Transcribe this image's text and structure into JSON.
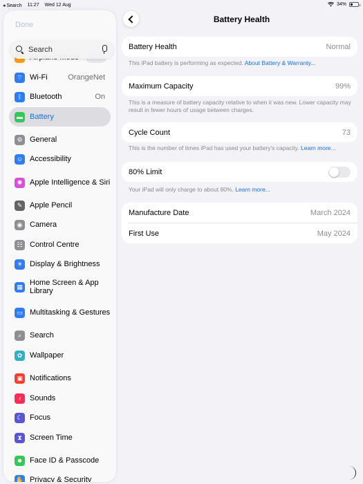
{
  "status_bar": {
    "back_app": "◂ Search",
    "time": "11:27",
    "date": "Wed 12 Aug",
    "battery": "34%",
    "battery_level": 0.34
  },
  "sidebar": {
    "done_label": "Done",
    "search_placeholder": "Search",
    "partial_item": "Airplane Mode",
    "items": [
      {
        "label": "Wi-Fi",
        "value": "OrangeNet",
        "icon": "wifi-icon",
        "color": "#2f7cf6"
      },
      {
        "label": "Bluetooth",
        "value": "On",
        "icon": "bluetooth-icon",
        "color": "#2f7cf6"
      },
      {
        "label": "Battery",
        "value": "",
        "icon": "battery-icon",
        "color": "#34c759"
      },
      {
        "label": "General",
        "value": "",
        "icon": "gear-icon",
        "color": "#8e8e93"
      },
      {
        "label": "Accessibility",
        "value": "",
        "icon": "accessibility-icon",
        "color": "#2f7cf6"
      },
      {
        "label": "Apple Intelligence & Siri",
        "value": "",
        "icon": "siri-icon",
        "color": "#d94fd8"
      },
      {
        "label": "Apple Pencil",
        "value": "",
        "icon": "pencil-icon",
        "color": "#636366"
      },
      {
        "label": "Camera",
        "value": "",
        "icon": "camera-icon",
        "color": "#8e8e93"
      },
      {
        "label": "Control Centre",
        "value": "",
        "icon": "control-centre-icon",
        "color": "#8e8e93"
      },
      {
        "label": "Display & Brightness",
        "value": "",
        "icon": "brightness-icon",
        "color": "#2f7cf6"
      },
      {
        "label": "Home Screen & App Library",
        "value": "",
        "icon": "home-screen-icon",
        "color": "#2f7cf6"
      },
      {
        "label": "Multitasking & Gestures",
        "value": "",
        "icon": "multitasking-icon",
        "color": "#2f7cf6"
      },
      {
        "label": "Search",
        "value": "",
        "icon": "search-icon",
        "color": "#8e8e93"
      },
      {
        "label": "Wallpaper",
        "value": "",
        "icon": "wallpaper-icon",
        "color": "#30b0c7"
      },
      {
        "label": "Notifications",
        "value": "",
        "icon": "notifications-icon",
        "color": "#ff3b30"
      },
      {
        "label": "Sounds",
        "value": "",
        "icon": "sounds-icon",
        "color": "#ff2d55"
      },
      {
        "label": "Focus",
        "value": "",
        "icon": "focus-icon",
        "color": "#5856d6"
      },
      {
        "label": "Screen Time",
        "value": "",
        "icon": "screen-time-icon",
        "color": "#5856d6"
      },
      {
        "label": "Face ID & Passcode",
        "value": "",
        "icon": "face-id-icon",
        "color": "#34c759"
      },
      {
        "label": "Privacy & Security",
        "value": "",
        "icon": "privacy-icon",
        "color": "#2f7cf6"
      }
    ]
  },
  "main": {
    "title": "Battery Health",
    "health": {
      "label": "Battery Health",
      "value": "Normal",
      "note": "This iPad battery is performing as expected. ",
      "note_link": "About Battery & Warranty..."
    },
    "capacity": {
      "label": "Maximum Capacity",
      "value": "99%",
      "note": "This is a measure of battery capacity relative to when it was new. Lower capacity may result in fewer hours of usage between charges."
    },
    "cycles": {
      "label": "Cycle Count",
      "value": "73",
      "note": "This is the number of times iPad has used your battery's capacity. ",
      "note_link": "Learn more..."
    },
    "limit": {
      "label": "80% Limit",
      "enabled": false,
      "note": "Your iPad will only charge to about 80%. ",
      "note_link": "Learn more..."
    },
    "dates": [
      {
        "label": "Manufacture Date",
        "value": "March 2024"
      },
      {
        "label": "First Use",
        "value": "May 2024"
      }
    ]
  }
}
